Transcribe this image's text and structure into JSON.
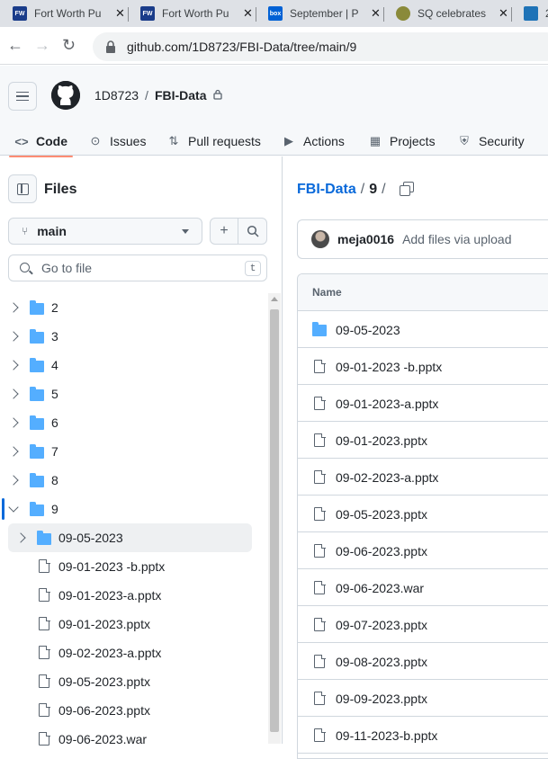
{
  "browser": {
    "tabs": [
      {
        "favicon": "fw",
        "favicon_text": "FW",
        "title": "Fort Worth Pu",
        "close": "✕"
      },
      {
        "favicon": "fw",
        "favicon_text": "FW",
        "title": "Fort Worth Pu",
        "close": "✕"
      },
      {
        "favicon": "box",
        "favicon_text": "box",
        "title": "September | P",
        "close": "✕"
      },
      {
        "favicon": "sq",
        "favicon_text": "",
        "title": "SQ celebrates",
        "close": "✕"
      },
      {
        "favicon": "z",
        "favicon_text": "",
        "title": "2",
        "close": ""
      }
    ],
    "url": "github.com/1D8723/FBI-Data/tree/main/9",
    "back_icon": "←",
    "forward_icon": "→",
    "reload_icon": "↻"
  },
  "github": {
    "owner": "1D8723",
    "separator": "/",
    "repo": "FBI-Data",
    "lock_icon": "🔒",
    "nav": [
      {
        "icon": "code-icon",
        "glyph": "<>",
        "label": "Code",
        "active": true
      },
      {
        "icon": "issues-icon",
        "glyph": "⊙",
        "label": "Issues",
        "active": false
      },
      {
        "icon": "pull-request-icon",
        "glyph": "⇅",
        "label": "Pull requests",
        "active": false
      },
      {
        "icon": "actions-icon",
        "glyph": "▶",
        "label": "Actions",
        "active": false
      },
      {
        "icon": "projects-icon",
        "glyph": "▦",
        "label": "Projects",
        "active": false
      },
      {
        "icon": "security-icon",
        "glyph": "⛨",
        "label": "Security",
        "active": false
      },
      {
        "icon": "insights-icon",
        "glyph": "⌊",
        "label": "",
        "active": false
      }
    ]
  },
  "sidebar": {
    "title": "Files",
    "branch": "main",
    "branch_icon": "⑂",
    "add_icon": "+",
    "search_icon": "⌕",
    "goto_placeholder": "Go to file",
    "goto_key": "t",
    "tree": [
      {
        "level": 0,
        "type": "folder",
        "name": "2",
        "expanded": false
      },
      {
        "level": 0,
        "type": "folder",
        "name": "3",
        "expanded": false
      },
      {
        "level": 0,
        "type": "folder",
        "name": "4",
        "expanded": false
      },
      {
        "level": 0,
        "type": "folder",
        "name": "5",
        "expanded": false
      },
      {
        "level": 0,
        "type": "folder",
        "name": "6",
        "expanded": false
      },
      {
        "level": 0,
        "type": "folder",
        "name": "7",
        "expanded": false
      },
      {
        "level": 0,
        "type": "folder",
        "name": "8",
        "expanded": false
      },
      {
        "level": 0,
        "type": "folder",
        "name": "9",
        "expanded": true,
        "active": true
      },
      {
        "level": 1,
        "type": "folder",
        "name": "09-05-2023",
        "expanded": false,
        "selected": true
      },
      {
        "level": 1,
        "type": "file",
        "name": "09-01-2023 -b.pptx"
      },
      {
        "level": 1,
        "type": "file",
        "name": "09-01-2023-a.pptx"
      },
      {
        "level": 1,
        "type": "file",
        "name": "09-01-2023.pptx"
      },
      {
        "level": 1,
        "type": "file",
        "name": "09-02-2023-a.pptx"
      },
      {
        "level": 1,
        "type": "file",
        "name": "09-05-2023.pptx"
      },
      {
        "level": 1,
        "type": "file",
        "name": "09-06-2023.pptx"
      },
      {
        "level": 1,
        "type": "file",
        "name": "09-06-2023.war"
      }
    ]
  },
  "main": {
    "repo_link": "FBI-Data",
    "sep1": "/",
    "dir": "9",
    "sep2": "/",
    "commit": {
      "author": "meja0016",
      "message": "Add files via upload"
    },
    "table_header": "Name",
    "files": [
      {
        "type": "folder",
        "name": "09-05-2023"
      },
      {
        "type": "file",
        "name": "09-01-2023 -b.pptx"
      },
      {
        "type": "file",
        "name": "09-01-2023-a.pptx"
      },
      {
        "type": "file",
        "name": "09-01-2023.pptx"
      },
      {
        "type": "file",
        "name": "09-02-2023-a.pptx"
      },
      {
        "type": "file",
        "name": "09-05-2023.pptx"
      },
      {
        "type": "file",
        "name": "09-06-2023.pptx"
      },
      {
        "type": "file",
        "name": "09-06-2023.war"
      },
      {
        "type": "file",
        "name": "09-07-2023.pptx"
      },
      {
        "type": "file",
        "name": "09-08-2023.pptx"
      },
      {
        "type": "file",
        "name": "09-09-2023.pptx"
      },
      {
        "type": "file",
        "name": "09-11-2023-b.pptx"
      }
    ]
  }
}
